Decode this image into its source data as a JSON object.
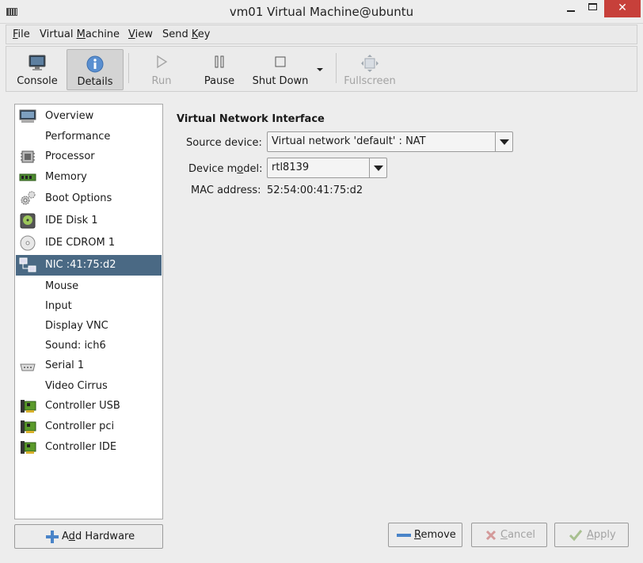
{
  "window": {
    "title": "vm01 Virtual Machine@ubuntu",
    "minimize_glyph": "",
    "maximize_glyph": "",
    "close_glyph": "✕"
  },
  "menubar": {
    "file": {
      "u": "F",
      "rest": "ile"
    },
    "virtual_machine": {
      "pre": "Virtual ",
      "u": "M",
      "rest": "achine"
    },
    "view": {
      "u": "V",
      "rest": "iew"
    },
    "send_key": {
      "pre": "Send ",
      "u": "K",
      "rest": "ey"
    }
  },
  "toolbar": {
    "console": "Console",
    "details": "Details",
    "run": "Run",
    "pause": "Pause",
    "shut_down": "Shut Down",
    "fullscreen": "Fullscreen"
  },
  "hardware_list": [
    {
      "label": "Overview",
      "icon": "monitor-icon"
    },
    {
      "label": "Performance",
      "icon": "performance-icon"
    },
    {
      "label": "Processor",
      "icon": "cpu-icon"
    },
    {
      "label": "Memory",
      "icon": "memory-icon"
    },
    {
      "label": "Boot Options",
      "icon": "gears-icon"
    },
    {
      "label": "IDE Disk 1",
      "icon": "harddisk-icon"
    },
    {
      "label": "IDE CDROM 1",
      "icon": "cdrom-icon"
    },
    {
      "label": "NIC :41:75:d2",
      "icon": "network-icon",
      "selected": true
    },
    {
      "label": "Mouse",
      "icon": "mouse-icon"
    },
    {
      "label": "Input",
      "icon": "input-icon"
    },
    {
      "label": "Display VNC",
      "icon": "display-icon"
    },
    {
      "label": "Sound: ich6",
      "icon": "sound-icon"
    },
    {
      "label": "Serial 1",
      "icon": "serial-icon"
    },
    {
      "label": "Video Cirrus",
      "icon": "video-icon"
    },
    {
      "label": "Controller USB",
      "icon": "pci-card-icon"
    },
    {
      "label": "Controller pci",
      "icon": "pci-card-icon"
    },
    {
      "label": "Controller IDE",
      "icon": "pci-card-icon"
    }
  ],
  "details": {
    "section_title": "Virtual Network Interface",
    "source_device_label": "Source device:",
    "source_device_value": "Virtual network 'default' : NAT",
    "device_model_label_pre": "Device m",
    "device_model_label_u": "o",
    "device_model_label_post": "del:",
    "device_model_value": "rtl8139",
    "mac_address_label": "MAC address:",
    "mac_address_value": "52:54:00:41:75:d2"
  },
  "buttons": {
    "add_hardware": {
      "pre": "A",
      "u": "d",
      "rest": "d Hardware"
    },
    "remove": {
      "u": "R",
      "rest": "emove"
    },
    "cancel": {
      "u": "C",
      "rest": "ancel"
    },
    "apply": {
      "u": "A",
      "rest": "pply"
    }
  },
  "colors": {
    "selection": "#4a6984",
    "close_button": "#c7403a"
  }
}
